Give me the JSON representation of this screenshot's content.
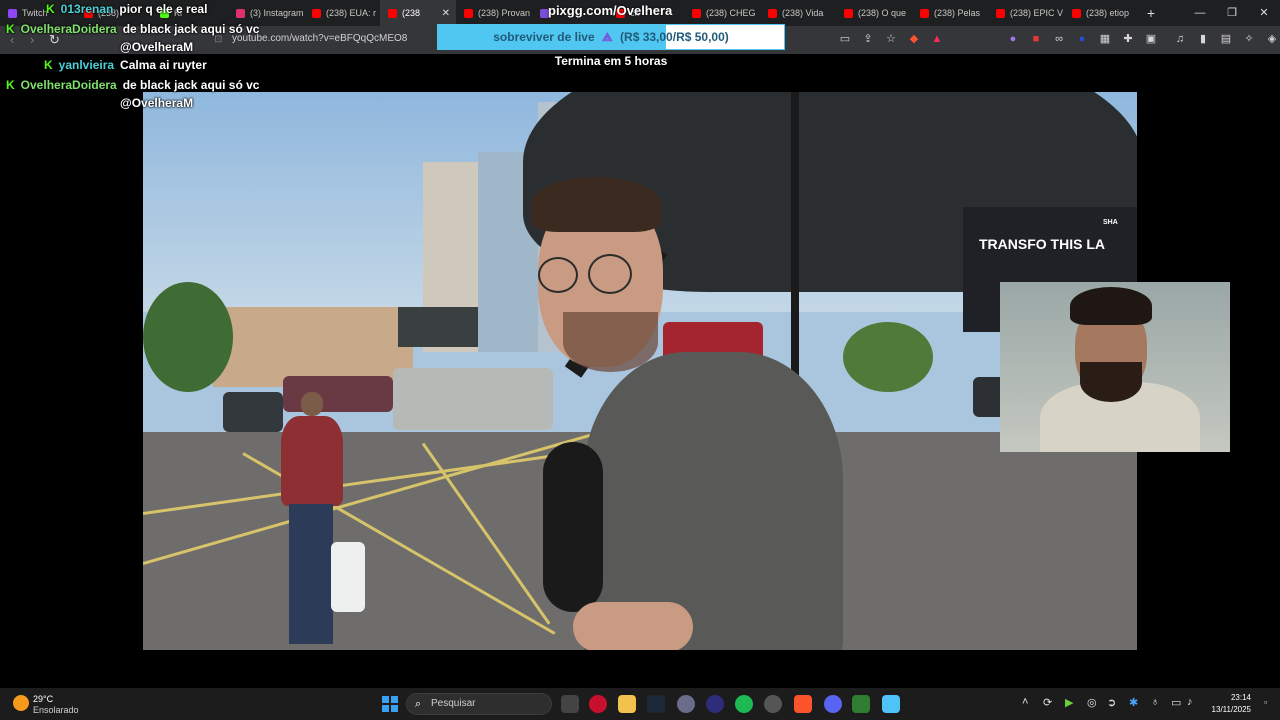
{
  "browser": {
    "tabs": [
      {
        "label": "Twitch",
        "color": "#9146ff"
      },
      {
        "label": "(238)",
        "color": "#ff0000"
      },
      {
        "label": "Ki",
        "color": "#53fc18"
      },
      {
        "label": "(3) Instagram",
        "color": "#e1306c"
      },
      {
        "label": "(238) EUA: r",
        "color": "#ff0000"
      },
      {
        "label": "(238",
        "color": "#ff0000",
        "active": true
      },
      {
        "label": "(238) Provan",
        "color": "#ff0000"
      },
      {
        "label": "",
        "color": "#7a4cd8"
      },
      {
        "label": "ck",
        "color": "#ff0000"
      },
      {
        "label": "(238) CHEG",
        "color": "#ff0000"
      },
      {
        "label": "(238) Vida",
        "color": "#ff0000"
      },
      {
        "label": "(238) O que",
        "color": "#ff0000"
      },
      {
        "label": "(238) Pelas",
        "color": "#ff0000"
      },
      {
        "label": "(238) EPIC V",
        "color": "#ff0000"
      },
      {
        "label": "(238) etiop",
        "color": "#ff0000"
      }
    ],
    "new_tab": "+",
    "url": "youtube.com/watch?v=eBFQqQcMEO8",
    "window_controls": [
      "—",
      "❐",
      "✕"
    ]
  },
  "overlay": {
    "pix_title": "pixgg.com/Ovelhera",
    "goal_label": "sobreviver de live",
    "goal_amount": "(R$ 33,00/R$ 50,00)",
    "goal_progress": 0.66,
    "goal_ends": "Termina em 5 horas"
  },
  "chat": [
    {
      "user": "013renan",
      "text": "pior q ele e real",
      "badge": "K"
    },
    {
      "user": "OvelheraDoidera",
      "text": "de black jack aqui só vc",
      "mention": "@OvelheraM",
      "badge": "K"
    },
    {
      "user": "yanlvieira",
      "text": "Calma ai ruyter",
      "badge": "K"
    },
    {
      "user": "OvelheraDoidera",
      "text": "de black jack aqui só vc",
      "mention": "@OvelheraM",
      "badge": "K"
    }
  ],
  "video": {
    "billboard_text": "TRANSFO THIS LA",
    "billboard_brand": "SHA"
  },
  "taskbar": {
    "temperature": "29°C",
    "weather": "Ensolarado",
    "search_placeholder": "Pesquisar",
    "time": "23:14",
    "date": "13/11/2025"
  }
}
